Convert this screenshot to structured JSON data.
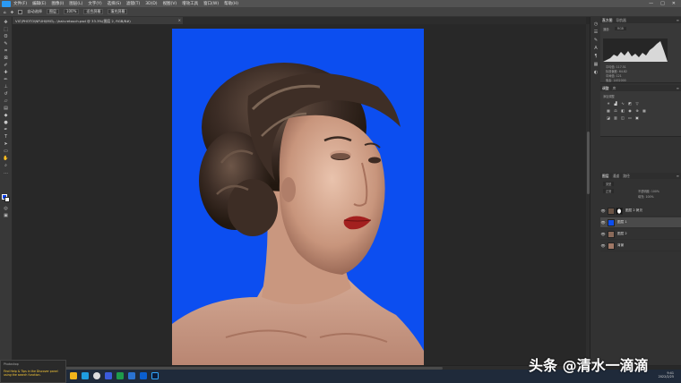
{
  "app": {
    "menu": [
      "文件(F)",
      "编辑(E)",
      "图像(I)",
      "图层(L)",
      "文字(Y)",
      "选择(S)",
      "滤镜(T)",
      "3D(D)",
      "视图(V)",
      "增效工具",
      "窗口(W)",
      "帮助(H)"
    ],
    "window_controls": [
      "—",
      "□",
      "✕"
    ]
  },
  "options_bar": {
    "auto_select_label": "自动选择",
    "auto_select_value": "图层",
    "zoom_label": "100%",
    "fit_screen_label": "适合屏幕",
    "fill_screen_label": "填充屏幕"
  },
  "document": {
    "tab_title": "VIC\\PHOTO\\NFUH\\IMG\\...\\hair-retouch.psd @ 33.3%(图层 2, RGB/8#)",
    "close_glyph": "×"
  },
  "toolbar": {
    "tools": [
      "move-tool",
      "marquee-tool",
      "lasso-tool",
      "quick-select-tool",
      "crop-tool",
      "frame-tool",
      "eyedropper-tool",
      "healing-tool",
      "brush-tool",
      "stamp-tool",
      "history-brush-tool",
      "eraser-tool",
      "gradient-tool",
      "blur-tool",
      "dodge-tool",
      "pen-tool",
      "type-tool",
      "path-select-tool",
      "shape-tool",
      "hand-tool",
      "zoom-tool",
      "edit-toolbar-tool"
    ],
    "fg_color": "#0d3fe8",
    "bg_color": "#ffffff"
  },
  "panels": {
    "histogram": {
      "tabs": [
        "直方图",
        "导航器"
      ],
      "channel_label": "通道:",
      "channel_value": "RGB",
      "stats": [
        "平均值: 117.51",
        "标准偏差: 64.82",
        "中间值: 121",
        "像素: 1452000"
      ]
    },
    "adjustments": {
      "tabs": [
        "调整",
        "库"
      ],
      "hint": "添加调整"
    },
    "layers": {
      "tabs": [
        "图层",
        "通道",
        "路径"
      ],
      "kind_label": "类型",
      "blend_mode": "正常",
      "opacity_label": "不透明度: 100%",
      "fill_label": "填充: 100%",
      "items": [
        {
          "name": "图层 2 拷贝",
          "visible": true,
          "selected": false,
          "thumb": "#6b5547",
          "has_mask": true
        },
        {
          "name": "图层 1",
          "visible": true,
          "selected": true,
          "thumb": "#0c4ef0",
          "has_mask": false
        },
        {
          "name": "图层 2",
          "visible": true,
          "selected": false,
          "thumb": "#8a6a5a",
          "has_mask": false
        },
        {
          "name": "背景",
          "visible": true,
          "selected": false,
          "thumb": "#a07866",
          "has_mask": false
        }
      ]
    }
  },
  "canvas": {
    "background_color": "#0c4ef0"
  },
  "notification": {
    "title": "Photoshop",
    "text": "Find Help & Tips in the Discover panel using the search function."
  },
  "taskbar": {
    "clock_time": "9:41",
    "clock_date": "2022/2/25"
  },
  "watermark": "头条 @清水一滴滴"
}
